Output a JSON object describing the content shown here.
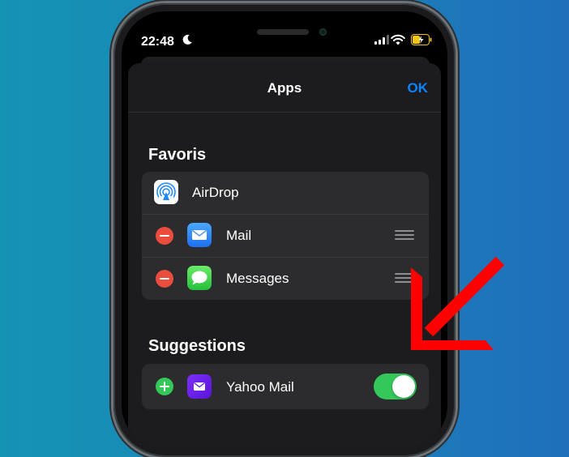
{
  "status_bar": {
    "time": "22:48",
    "icons": [
      "moon-icon",
      "signal-icon",
      "wifi-icon",
      "battery-charging-icon"
    ]
  },
  "sheet": {
    "title": "Apps",
    "ok_label": "OK"
  },
  "favorites": {
    "title": "Favoris",
    "items": [
      {
        "label": "AirDrop",
        "icon": "airdrop-icon"
      },
      {
        "label": "Mail",
        "icon": "mail-icon"
      },
      {
        "label": "Messages",
        "icon": "messages-icon"
      }
    ]
  },
  "suggestions": {
    "title": "Suggestions",
    "items": [
      {
        "label": "Yahoo Mail",
        "icon": "yahoo-mail-icon",
        "enabled": true
      }
    ]
  },
  "annotation": {
    "arrow_color": "#ff0000"
  },
  "colors": {
    "accent": "#0a84ff",
    "remove": "#ea4d3d",
    "add": "#34c759",
    "toggle_on": "#34c759"
  }
}
